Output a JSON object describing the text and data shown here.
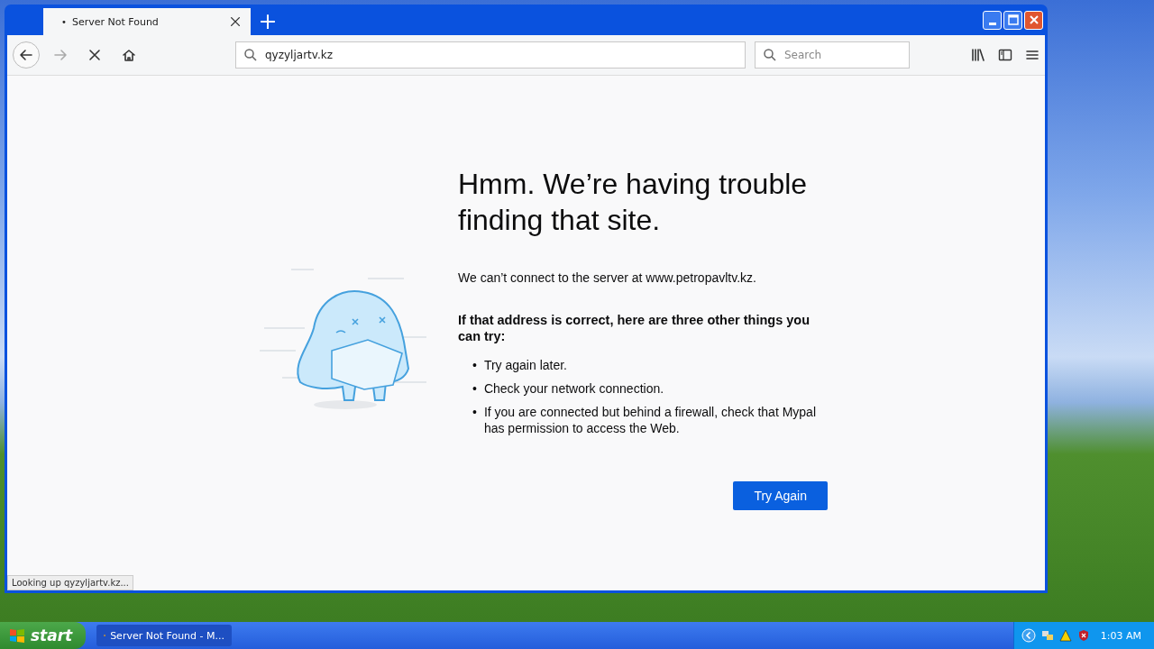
{
  "window": {
    "tab": {
      "indicator": "•",
      "title": "Server Not Found"
    },
    "loading": true,
    "address": "qyzyljartv.kz",
    "search_placeholder": "Search"
  },
  "error": {
    "heading": "Hmm. We’re having trouble finding that site.",
    "message": "We can’t connect to the server at www.petropavltv.kz.",
    "suggestion_title": "If that address is correct, here are three other things you can try:",
    "suggestions": [
      {
        "bullet": "•",
        "text": "Try again later."
      },
      {
        "bullet": "•",
        "text": "Check your network connection."
      },
      {
        "bullet": "•",
        "text": "If you are connected but behind a firewall, check that Mypal has permission to access the Web."
      }
    ],
    "button": "Try Again"
  },
  "status_bar": "Looking up qyzyljartv.kz...",
  "taskbar": {
    "start": "start",
    "tasks": [
      {
        "label": "Server Not Found - M...",
        "selected": true
      }
    ],
    "clock": "1:03 AM"
  }
}
